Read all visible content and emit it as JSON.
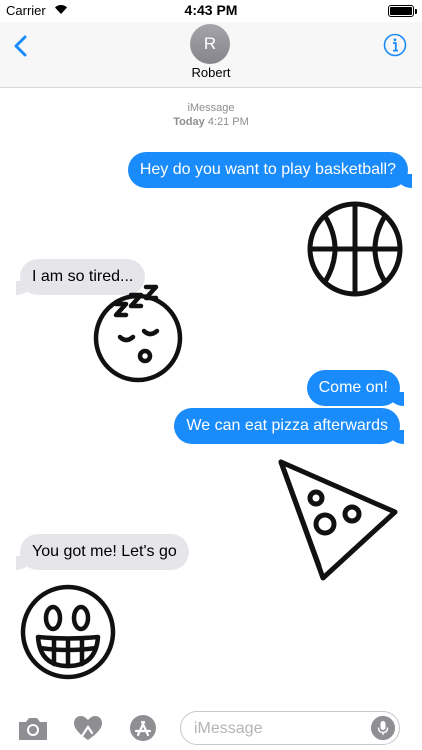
{
  "status_bar": {
    "carrier": "Carrier",
    "time": "4:43 PM",
    "signal_icon": "wifi-icon",
    "battery_icon": "battery-icon"
  },
  "header": {
    "avatar_initial": "R",
    "contact_name": "Robert",
    "back_icon": "chevron-left-icon",
    "info_icon": "info-icon"
  },
  "conversation": {
    "service": "iMessage",
    "date_label": "Today",
    "time_label": "4:21 PM",
    "messages": [
      {
        "from": "me",
        "text": "Hey do you want to play basketball?"
      },
      {
        "from": "them",
        "text": "I am so tired..."
      },
      {
        "from": "me",
        "text": "Come on!"
      },
      {
        "from": "me",
        "text": "We can eat pizza afterwards"
      },
      {
        "from": "them",
        "text": "You got me! Let's go"
      }
    ],
    "stickers": [
      "basketball-sticker",
      "sleepy-face-sticker",
      "pizza-slice-sticker",
      "grinning-face-sticker"
    ]
  },
  "input_bar": {
    "placeholder": "iMessage",
    "value": "",
    "icons": [
      "camera-icon",
      "digital-touch-heart-icon",
      "app-store-icon",
      "microphone-icon"
    ]
  },
  "colors": {
    "outgoing_bubble": "#1a8bfb",
    "incoming_bubble": "#e5e5ea",
    "accent": "#1a8bfb",
    "gray_icon": "#8e8e93"
  }
}
